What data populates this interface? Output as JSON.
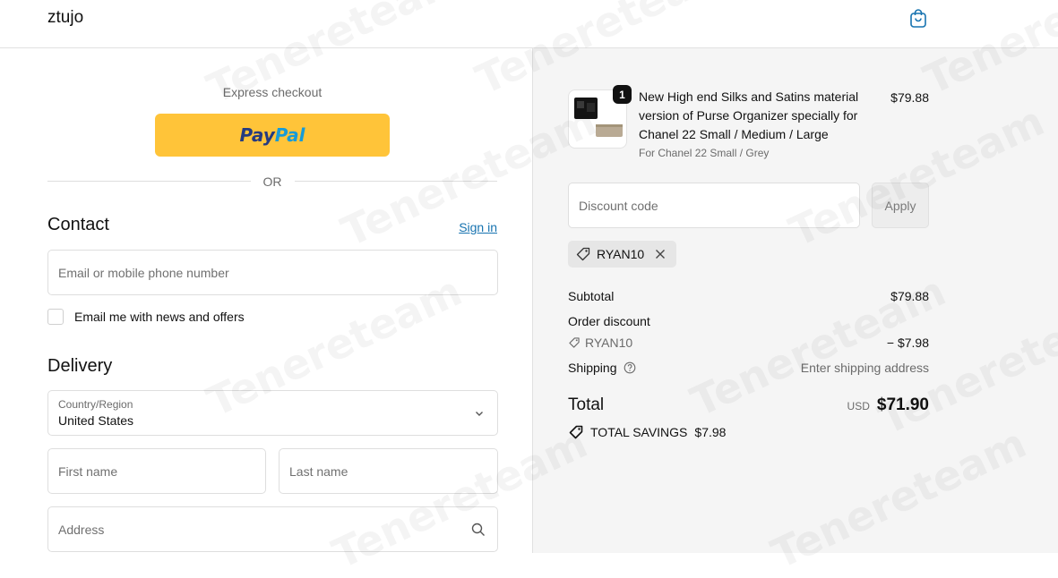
{
  "header": {
    "brand": "ztujo",
    "cart_icon": "shopping-bag-icon"
  },
  "express": {
    "label": "Express checkout",
    "paypal_a": "Pay",
    "paypal_b": "Pal",
    "or": "OR"
  },
  "contact": {
    "title": "Contact",
    "signin": "Sign in",
    "email_placeholder": "Email or mobile phone number",
    "newsletter_label": "Email me with news and offers"
  },
  "delivery": {
    "title": "Delivery",
    "country_label": "Country/Region",
    "country_value": "United States",
    "first_name_placeholder": "First name",
    "last_name_placeholder": "Last name",
    "address_placeholder": "Address"
  },
  "order": {
    "quantity": "1",
    "product_title": "New High end Silks and Satins material version of Purse Organizer specially for Chanel 22 Small / Medium / Large",
    "product_variant": "For Chanel 22 Small / Grey",
    "product_price": "$79.88",
    "discount_placeholder": "Discount code",
    "apply_label": "Apply",
    "applied_code": "RYAN10",
    "subtotal_label": "Subtotal",
    "subtotal_value": "$79.88",
    "order_discount_label": "Order discount",
    "discount_code_label": "RYAN10",
    "discount_value": "− $7.98",
    "shipping_label": "Shipping",
    "shipping_value": "Enter shipping address",
    "total_label": "Total",
    "currency": "USD",
    "total_value": "$71.90",
    "savings_label": "TOTAL SAVINGS",
    "savings_value": "$7.98"
  },
  "watermark": {
    "text": "Tenereteam"
  },
  "colors": {
    "paypal_button": "#ffc439",
    "link": "#1773b0",
    "summary_bg": "#f5f5f5"
  }
}
